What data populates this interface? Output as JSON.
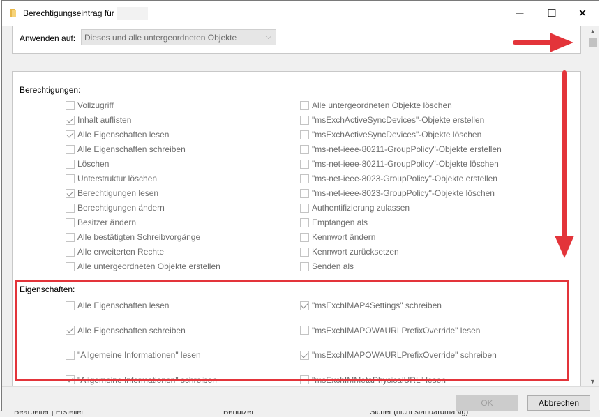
{
  "window": {
    "title": "Berechtigungseintrag für",
    "close_symbol": "✕",
    "maximize_symbol": "☐",
    "minimize_symbol": "—"
  },
  "apply_to": {
    "label": "Anwenden auf:",
    "value": "Dieses und alle untergeordneten Objekte"
  },
  "permissions": {
    "title": "Berechtigungen:",
    "left": [
      {
        "label": "Vollzugriff",
        "checked": false
      },
      {
        "label": "Inhalt auflisten",
        "checked": true
      },
      {
        "label": "Alle Eigenschaften lesen",
        "checked": true
      },
      {
        "label": "Alle Eigenschaften schreiben",
        "checked": false
      },
      {
        "label": "Löschen",
        "checked": false
      },
      {
        "label": "Unterstruktur löschen",
        "checked": false
      },
      {
        "label": "Berechtigungen lesen",
        "checked": true
      },
      {
        "label": "Berechtigungen ändern",
        "checked": false
      },
      {
        "label": "Besitzer ändern",
        "checked": false
      },
      {
        "label": "Alle bestätigten Schreibvorgänge",
        "checked": false
      },
      {
        "label": "Alle erweiterten Rechte",
        "checked": false
      },
      {
        "label": "Alle untergeordneten Objekte erstellen",
        "checked": false
      }
    ],
    "right": [
      {
        "label": "Alle untergeordneten Objekte löschen",
        "checked": false
      },
      {
        "label": "\"msExchActiveSyncDevices\"-Objekte erstellen",
        "checked": false
      },
      {
        "label": "\"msExchActiveSyncDevices\"-Objekte löschen",
        "checked": false
      },
      {
        "label": "\"ms-net-ieee-80211-GroupPolicy\"-Objekte erstellen",
        "checked": false
      },
      {
        "label": "\"ms-net-ieee-80211-GroupPolicy\"-Objekte löschen",
        "checked": false
      },
      {
        "label": "\"ms-net-ieee-8023-GroupPolicy\"-Objekte erstellen",
        "checked": false
      },
      {
        "label": "\"ms-net-ieee-8023-GroupPolicy\"-Objekte löschen",
        "checked": false
      },
      {
        "label": "Authentifizierung zulassen",
        "checked": false
      },
      {
        "label": "Empfangen als",
        "checked": false
      },
      {
        "label": "Kennwort ändern",
        "checked": false
      },
      {
        "label": "Kennwort zurücksetzen",
        "checked": false
      },
      {
        "label": "Senden als",
        "checked": false
      }
    ]
  },
  "properties": {
    "title": "Eigenschaften:",
    "left": [
      {
        "label": "Alle Eigenschaften lesen",
        "checked": false
      },
      {
        "label": "Alle Eigenschaften schreiben",
        "checked": true
      },
      {
        "label": "\"Allgemeine Informationen\" lesen",
        "checked": false
      },
      {
        "label": "\"Allgemeine Informationen\" schreiben",
        "checked": true
      }
    ],
    "right": [
      {
        "label": "\"msExchIMAP4Settings\" schreiben",
        "checked": true
      },
      {
        "label": "\"msExchIMAPOWAURLPrefixOverride\" lesen",
        "checked": false
      },
      {
        "label": "\"msExchIMAPOWAURLPrefixOverride\" schreiben",
        "checked": true
      },
      {
        "label": "\"msExchIMMetaPhysicalURL\" lesen",
        "checked": false
      }
    ]
  },
  "footer": {
    "ok_label": "OK",
    "cancel_label": "Abbrechen"
  },
  "background_strip": [
    "Bearbeiter | Ersteller",
    "Benutzer",
    "Sicher (nicht standardmäßig)"
  ],
  "annotation_color": "#e3343a"
}
